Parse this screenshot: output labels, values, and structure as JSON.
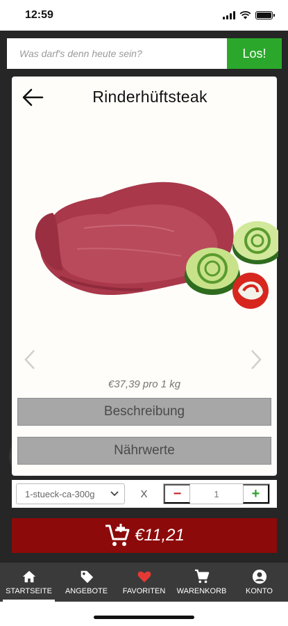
{
  "status_bar": {
    "time": "12:59"
  },
  "search": {
    "placeholder": "Was darf's denn heute sein?",
    "button_label": "Los!"
  },
  "product": {
    "title": "Rinderhüftsteak",
    "price_per_unit": "€37,39 pro 1 kg",
    "description_label": "Beschreibung",
    "nutrition_label": "Nährwerte"
  },
  "options": {
    "variant_selected": "1-stueck-ca-300g",
    "times_symbol": "X",
    "quantity": "1",
    "minus_symbol": "−",
    "plus_symbol": "+"
  },
  "cart": {
    "price": "€11,21"
  },
  "nav": {
    "items": [
      {
        "label": "STARTSEITE",
        "icon": "home-icon",
        "active": true
      },
      {
        "label": "ANGEBOTE",
        "icon": "tag-icon",
        "active": false
      },
      {
        "label": "FAVORITEN",
        "icon": "heart-icon",
        "active": false
      },
      {
        "label": "WARENKORB",
        "icon": "cart-icon",
        "active": false
      },
      {
        "label": "KONTO",
        "icon": "account-icon",
        "active": false
      }
    ]
  },
  "colors": {
    "accent_green": "#2ba82b",
    "cart_red": "#8c0a0a",
    "heart_red": "#e53935",
    "nav_bg": "#3a3a3a"
  }
}
